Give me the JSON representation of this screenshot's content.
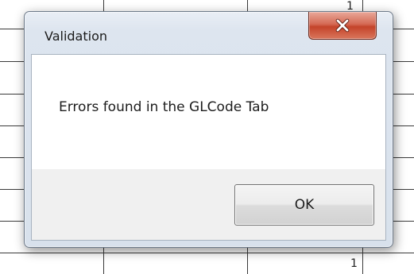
{
  "dialog": {
    "title": "Validation",
    "message": "Errors found in the GLCode Tab",
    "ok_label": "OK",
    "close_icon": "close-icon"
  },
  "spreadsheet": {
    "cell_values": [
      "1",
      "1"
    ]
  },
  "colors": {
    "close_button": "#c4432a",
    "frame": "#d8e1ec",
    "button_bar": "#f0f0f0"
  }
}
